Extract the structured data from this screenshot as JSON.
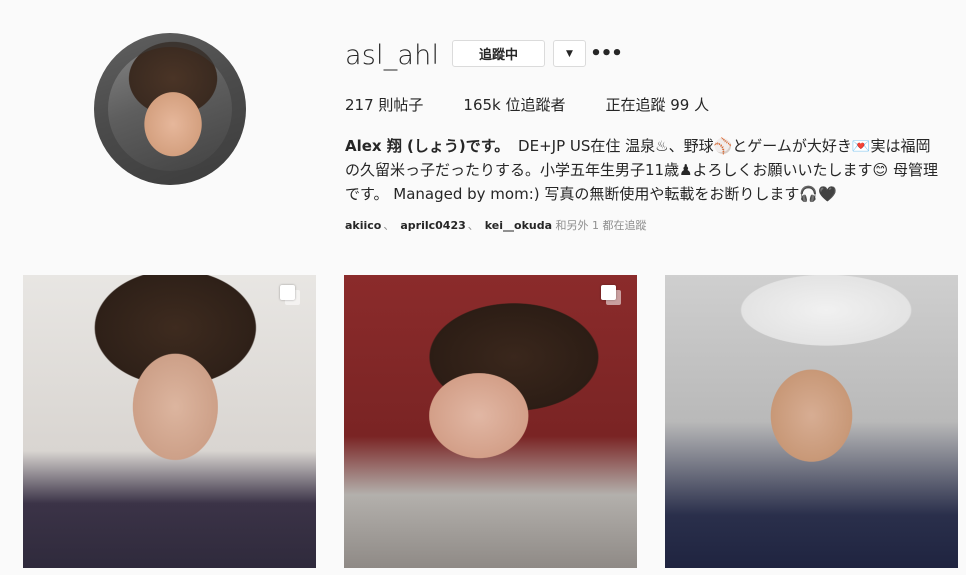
{
  "profile": {
    "username": "asl_ahl",
    "follow_label": "追蹤中",
    "dropdown_glyph": "▼",
    "more_glyph": "•••",
    "stats": {
      "posts": "217 則帖子",
      "followers": "165k 位追蹤者",
      "following": "正在追蹤 99 人"
    },
    "bio": {
      "name": "Alex 翔 (しょう)です。",
      "text": "DE+JP US在住 温泉♨、野球⚾とゲームが大好き💌実は福岡の久留米っ子だったりする。小学五年生男子11歳♟よろしくお願いいたします😊 母管理です。 Managed by mom:) 写真の無断使用や転載をお断りします🎧🖤"
    },
    "mutual": {
      "users": [
        "akiico",
        "aprilc0423",
        "kei__okuda"
      ],
      "separator": "、",
      "suffix": "和另外 1 都在追蹤"
    }
  },
  "posts": [
    {
      "multi": true
    },
    {
      "multi": true
    },
    {
      "multi": false
    }
  ]
}
